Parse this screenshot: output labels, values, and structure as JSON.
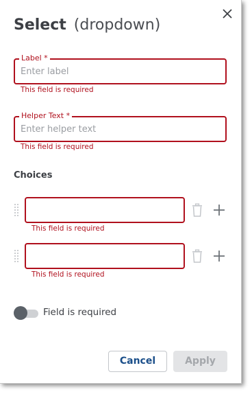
{
  "dialog": {
    "title": "Select",
    "subtitle": "(dropdown)"
  },
  "label_field": {
    "label": "Label *",
    "placeholder": "Enter label",
    "value": "",
    "error": "This field is required"
  },
  "helper_field": {
    "label": "Helper Text *",
    "placeholder": "Enter helper text",
    "value": "",
    "error": "This field is required"
  },
  "choices": {
    "title": "Choices",
    "items": [
      {
        "value": "",
        "error": "This field is required"
      },
      {
        "value": "",
        "error": "This field is required"
      }
    ]
  },
  "required_toggle": {
    "label": "Field is required",
    "on": false
  },
  "footer": {
    "cancel_label": "Cancel",
    "apply_label": "Apply",
    "apply_enabled": false
  },
  "colors": {
    "error": "#b0101d",
    "primary_text": "#1b4f8a",
    "title_text": "#3c3f44"
  },
  "icons": {
    "close": "close-icon",
    "drag": "drag-handle-icon",
    "delete": "trash-icon",
    "add": "plus-icon"
  }
}
